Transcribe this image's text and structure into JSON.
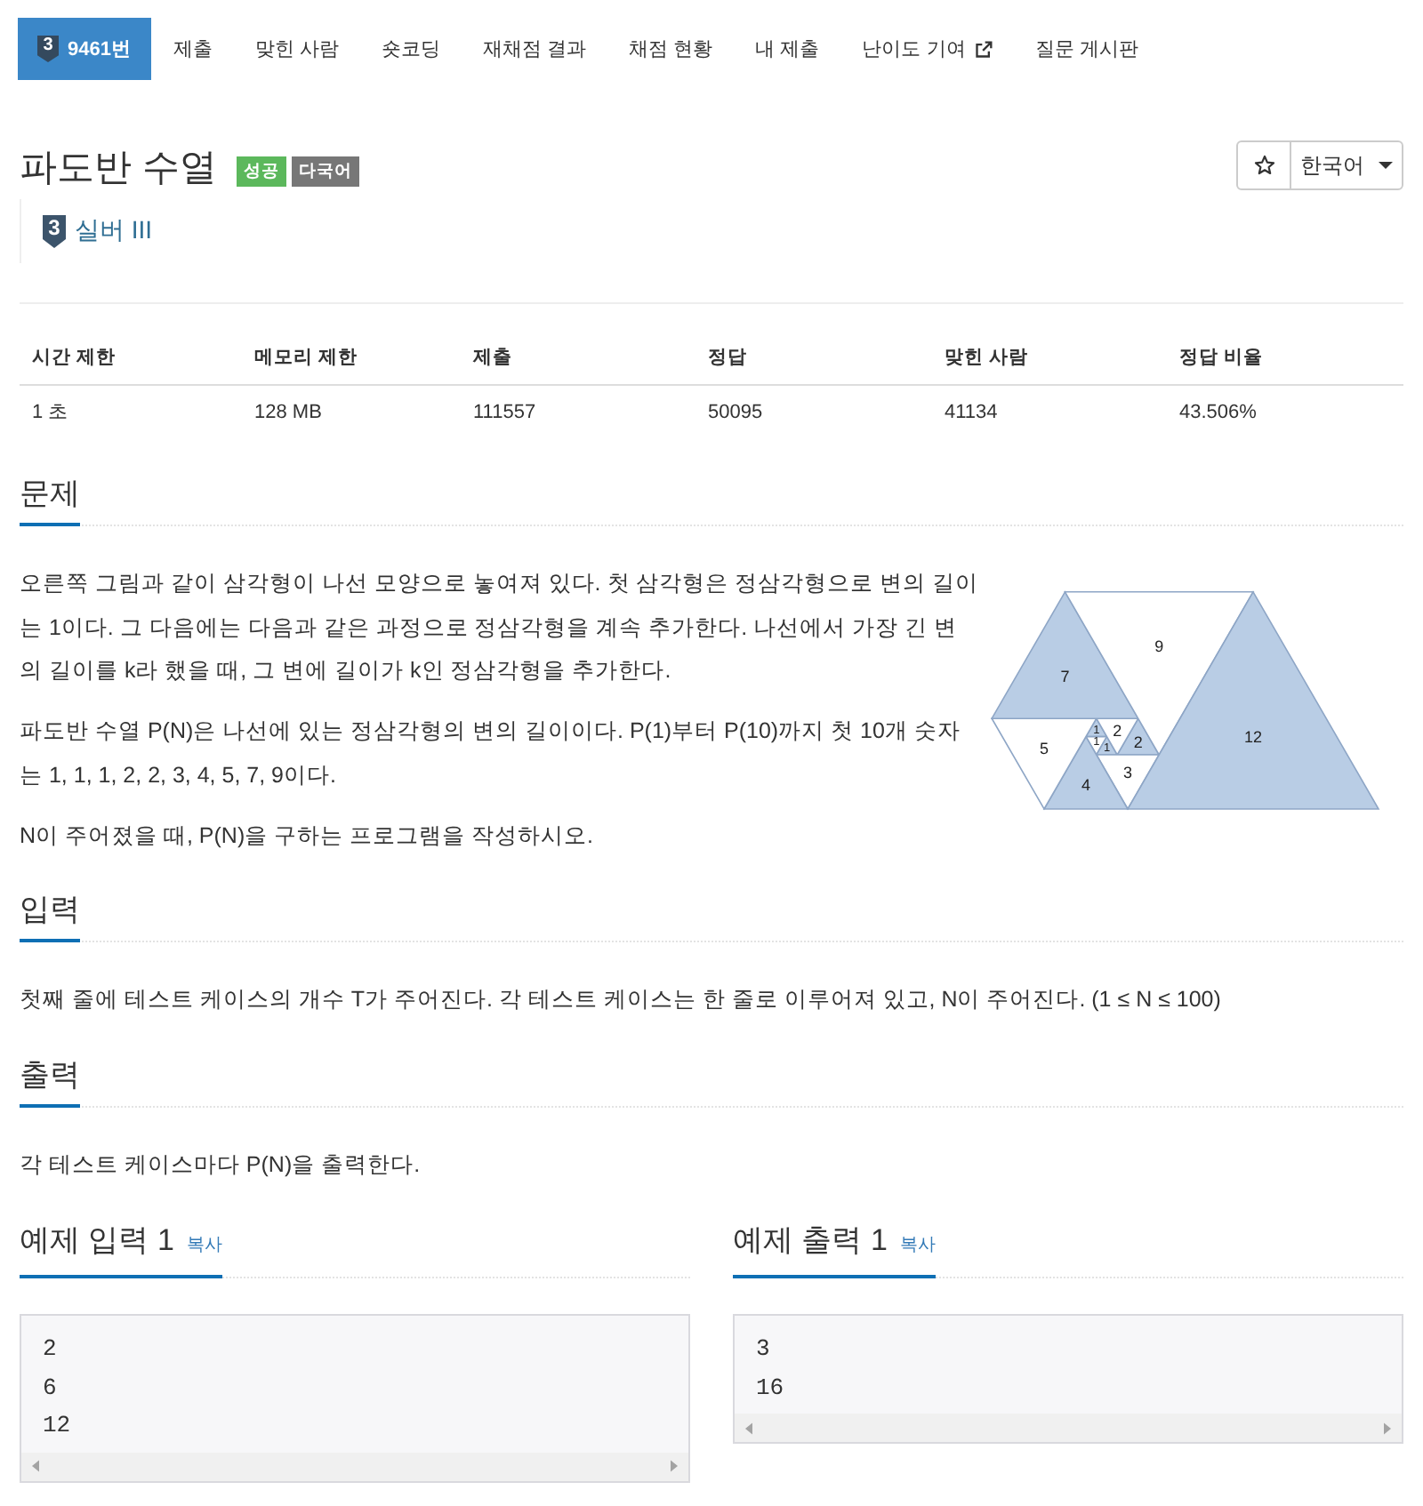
{
  "nav": {
    "tabs": [
      {
        "label": "9461번",
        "kind": "problem",
        "tier": "3",
        "selected": true
      },
      {
        "label": "제출",
        "kind": "link",
        "selected": false
      },
      {
        "label": "맞힌 사람",
        "kind": "link",
        "selected": false
      },
      {
        "label": "숏코딩",
        "kind": "link",
        "selected": false
      },
      {
        "label": "재채점 결과",
        "kind": "link",
        "selected": false
      },
      {
        "label": "채점 현황",
        "kind": "link",
        "selected": false
      },
      {
        "label": "내 제출",
        "kind": "link",
        "selected": false
      },
      {
        "label": "난이도 기여",
        "kind": "external",
        "selected": false
      },
      {
        "label": "질문 게시판",
        "kind": "link",
        "selected": false
      }
    ]
  },
  "problem": {
    "title": "파도반 수열",
    "tags": [
      {
        "label": "성공",
        "color": "#5cb85c"
      },
      {
        "label": "다국어",
        "color": "#777777"
      }
    ],
    "starred": false,
    "language": "한국어",
    "tier": {
      "number": "3",
      "label": "실버 III"
    }
  },
  "stats": {
    "columns": [
      "시간 제한",
      "메모리 제한",
      "제출",
      "정답",
      "맞힌 사람",
      "정답 비율"
    ],
    "rows": [
      [
        "1 초",
        "128 MB",
        "111557",
        "50095",
        "41134",
        "43.506%"
      ]
    ]
  },
  "sections": [
    {
      "title": "문제",
      "paragraphs": [
        "오른쪽 그림과 같이 삼각형이 나선 모양으로 놓여져 있다. 첫 삼각형은 정삼각형으로 변의 길이는 1이다. 그 다음에는 다음과 같은 과정으로 정삼각형을 계속 추가한다. 나선에서 가장 긴 변의 길이를 k라 했을 때, 그 변에 길이가 k인 정삼각형을 추가한다.",
        "파도반 수열 P(N)은 나선에 있는 정삼각형의 변의 길이이다. P(1)부터 P(10)까지 첫 10개 숫자는 1, 1, 1, 2, 2, 3, 4, 5, 7, 9이다.",
        "N이 주어졌을 때, P(N)을 구하는 프로그램을 작성하시오."
      ],
      "figure": {
        "triangles": [
          {
            "label": "1",
            "color": "#b9cde5"
          },
          {
            "label": "1",
            "color": "#ffffff"
          },
          {
            "label": "1",
            "color": "#b9cde5"
          },
          {
            "label": "2",
            "color": "#b9cde5"
          },
          {
            "label": "2",
            "color": "#ffffff"
          },
          {
            "label": "3",
            "color": "#ffffff"
          },
          {
            "label": "4",
            "color": "#b9cde5"
          },
          {
            "label": "5",
            "color": "#ffffff"
          },
          {
            "label": "7",
            "color": "#b9cde5"
          },
          {
            "label": "9",
            "color": "#ffffff"
          },
          {
            "label": "12",
            "color": "#b9cde5"
          }
        ]
      }
    },
    {
      "title": "입력",
      "paragraphs": [
        "첫째 줄에 테스트 케이스의 개수 T가 주어진다. 각 테스트 케이스는 한 줄로 이루어져 있고, N이 주어진다. (1 ≤ N ≤ 100)"
      ]
    },
    {
      "title": "출력",
      "paragraphs": [
        "각 테스트 케이스마다 P(N)을 출력한다."
      ]
    }
  ],
  "samples": [
    {
      "title": "예제 입력 1",
      "copy": "복사",
      "content": "2\n6\n12"
    },
    {
      "title": "예제 출력 1",
      "copy": "복사",
      "content": "3\n16"
    }
  ]
}
